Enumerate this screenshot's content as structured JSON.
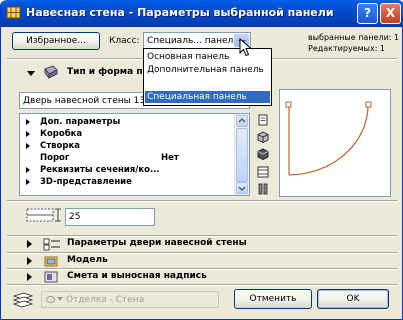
{
  "titlebar": {
    "title": "Навесная стена - Параметры выбранной панели",
    "help_label": "?",
    "close_label": "X"
  },
  "top": {
    "favorites_label": "Избранное...",
    "class_label": "Класс:",
    "class_value": "Специаль... панель",
    "selected_text": "выбранные панели: 1",
    "editable_text": "Редактируемых: 1"
  },
  "class_dropdown": {
    "options": [
      "Основная панель",
      "Дополнительная панель",
      "",
      "Специальная панель"
    ],
    "selected_index": 3
  },
  "type_section": {
    "title": "Тип и форма панел",
    "door_select_value": "Дверь навесной стены 13"
  },
  "param_list": {
    "items": [
      {
        "label": "Доп. параметры",
        "expandable": true,
        "value": ""
      },
      {
        "label": "Коробка",
        "expandable": true,
        "value": ""
      },
      {
        "label": "Створка",
        "expandable": true,
        "value": ""
      },
      {
        "label": "Порог",
        "expandable": false,
        "value": "Нет"
      },
      {
        "label": "Реквизиты сечения/ко...",
        "expandable": true,
        "value": ""
      },
      {
        "label": "3D-представление",
        "expandable": true,
        "value": ""
      }
    ]
  },
  "dimension": {
    "value": "25"
  },
  "sections": [
    {
      "label": "Параметры двери навесной стены"
    },
    {
      "label": "Модель"
    },
    {
      "label": "Смета и выносная надпись"
    }
  ],
  "footer": {
    "layer_value": "Отделка - Стена",
    "cancel_label": "Отменить",
    "ok_label": "OK"
  },
  "colors": {
    "titlebar": "#0453d6",
    "selection": "#316ac5",
    "background": "#ece9d8",
    "preview_line": "#c0622a"
  }
}
